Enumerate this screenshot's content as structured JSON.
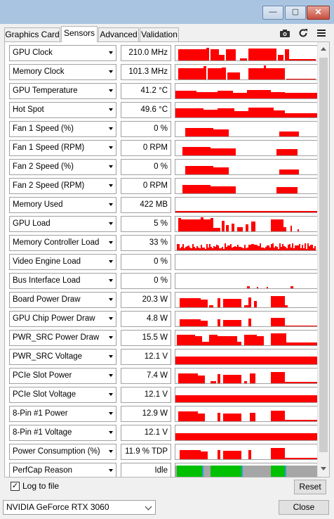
{
  "window": {
    "minimize_glyph": "—",
    "maximize_glyph": "▢",
    "close_glyph": "✕"
  },
  "tabs": [
    {
      "label": "Graphics Card",
      "active": false
    },
    {
      "label": "Sensors",
      "active": true
    },
    {
      "label": "Advanced",
      "active": false
    },
    {
      "label": "Validation",
      "active": false
    }
  ],
  "toolbar": {
    "camera_icon": "camera-icon",
    "refresh_icon": "refresh-icon",
    "menu_icon": "hamburger-menu-icon"
  },
  "colors": {
    "graph_fill": "#ff0000",
    "perfcap_idle": "#a6a6a6",
    "perfcap_green": "#00c000",
    "perfcap_blue": "#2aa0d8"
  },
  "sensors": [
    {
      "label": "GPU Clock",
      "value": "210.0 MHz"
    },
    {
      "label": "Memory Clock",
      "value": "101.3 MHz"
    },
    {
      "label": "GPU Temperature",
      "value": "41.2 °C"
    },
    {
      "label": "Hot Spot",
      "value": "49.6 °C"
    },
    {
      "label": "Fan 1 Speed (%)",
      "value": "0 %"
    },
    {
      "label": "Fan 1 Speed (RPM)",
      "value": "0 RPM"
    },
    {
      "label": "Fan 2 Speed (%)",
      "value": "0 %"
    },
    {
      "label": "Fan 2 Speed (RPM)",
      "value": "0 RPM"
    },
    {
      "label": "Memory Used",
      "value": "422 MB"
    },
    {
      "label": "GPU Load",
      "value": "5 %"
    },
    {
      "label": "Memory Controller Load",
      "value": "33 %"
    },
    {
      "label": "Video Engine Load",
      "value": "0 %"
    },
    {
      "label": "Bus Interface Load",
      "value": "0 %"
    },
    {
      "label": "Board Power Draw",
      "value": "20.3 W"
    },
    {
      "label": "GPU Chip Power Draw",
      "value": "4.8 W"
    },
    {
      "label": "PWR_SRC Power Draw",
      "value": "15.5 W"
    },
    {
      "label": "PWR_SRC Voltage",
      "value": "12.1 V"
    },
    {
      "label": "PCIe Slot Power",
      "value": "7.4 W"
    },
    {
      "label": "PCIe Slot Voltage",
      "value": "12.1 V"
    },
    {
      "label": "8-Pin #1 Power",
      "value": "12.9 W"
    },
    {
      "label": "8-Pin #1 Voltage",
      "value": "12.1 V"
    },
    {
      "label": "Power Consumption (%)",
      "value": "11.9 % TDP"
    },
    {
      "label": "PerfCap Reason",
      "value": "Idle"
    }
  ],
  "footer": {
    "log_checked": true,
    "log_label": "Log to file",
    "reset_label": "Reset",
    "gpu_select": "NVIDIA GeForce RTX 3060",
    "close_label": "Close"
  }
}
